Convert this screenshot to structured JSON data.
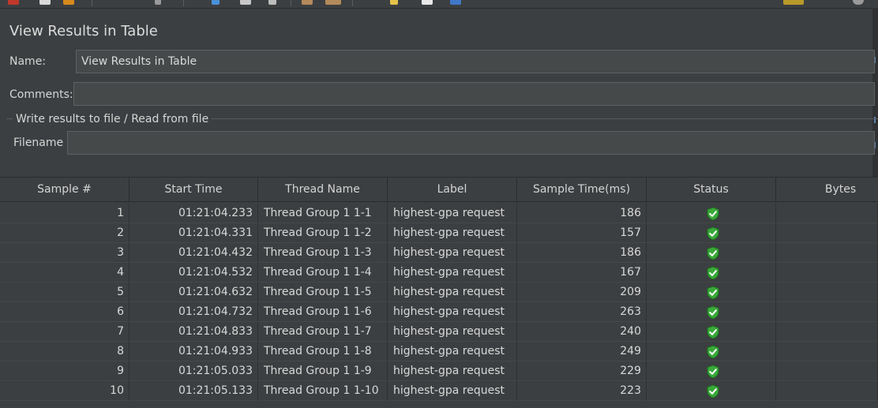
{
  "panel": {
    "title": "View Results in Table",
    "name_label": "Name:",
    "name_value": "View Results in Table",
    "comments_label": "Comments:",
    "comments_value": "",
    "file_group_title": "Write results to file / Read from file",
    "filename_label": "Filename",
    "filename_value": ""
  },
  "table": {
    "columns": [
      "Sample #",
      "Start Time",
      "Thread Name",
      "Label",
      "Sample Time(ms)",
      "Status",
      "Bytes"
    ],
    "rows": [
      {
        "sample": "1",
        "start_time": "01:21:04.233",
        "thread": "Thread Group 1 1-1",
        "label": "highest-gpa request",
        "sample_time": "186",
        "status": "success"
      },
      {
        "sample": "2",
        "start_time": "01:21:04.331",
        "thread": "Thread Group 1 1-2",
        "label": "highest-gpa request",
        "sample_time": "157",
        "status": "success"
      },
      {
        "sample": "3",
        "start_time": "01:21:04.432",
        "thread": "Thread Group 1 1-3",
        "label": "highest-gpa request",
        "sample_time": "186",
        "status": "success"
      },
      {
        "sample": "4",
        "start_time": "01:21:04.532",
        "thread": "Thread Group 1 1-4",
        "label": "highest-gpa request",
        "sample_time": "167",
        "status": "success"
      },
      {
        "sample": "5",
        "start_time": "01:21:04.632",
        "thread": "Thread Group 1 1-5",
        "label": "highest-gpa request",
        "sample_time": "209",
        "status": "success"
      },
      {
        "sample": "6",
        "start_time": "01:21:04.732",
        "thread": "Thread Group 1 1-6",
        "label": "highest-gpa request",
        "sample_time": "263",
        "status": "success"
      },
      {
        "sample": "7",
        "start_time": "01:21:04.833",
        "thread": "Thread Group 1 1-7",
        "label": "highest-gpa request",
        "sample_time": "240",
        "status": "success"
      },
      {
        "sample": "8",
        "start_time": "01:21:04.933",
        "thread": "Thread Group 1 1-8",
        "label": "highest-gpa request",
        "sample_time": "249",
        "status": "success"
      },
      {
        "sample": "9",
        "start_time": "01:21:05.033",
        "thread": "Thread Group 1 1-9",
        "label": "highest-gpa request",
        "sample_time": "229",
        "status": "success"
      },
      {
        "sample": "10",
        "start_time": "01:21:05.133",
        "thread": "Thread Group 1 1-10",
        "label": "highest-gpa request",
        "sample_time": "223",
        "status": "success"
      }
    ]
  },
  "icons": {
    "status_success": "shield-check-icon"
  },
  "colors": {
    "background": "#3c3f41",
    "field_background": "#45494a",
    "status_green": "#39a839"
  }
}
